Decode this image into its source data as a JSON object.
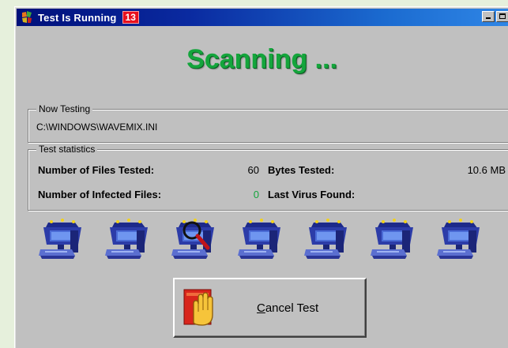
{
  "window": {
    "title": "Test Is Running",
    "badge": "13"
  },
  "headline": "Scanning ...",
  "now_testing": {
    "legend": "Now Testing",
    "path": "C:\\WINDOWS\\WAVEMIX.INI"
  },
  "stats": {
    "legend": "Test statistics",
    "files_tested_label": "Number of Files Tested:",
    "files_tested_value": "60",
    "bytes_tested_label": "Bytes Tested:",
    "bytes_tested_value": "10.6 MB",
    "infected_label": "Number of Infected Files:",
    "infected_value": "0",
    "last_virus_label": "Last Virus Found:",
    "last_virus_value": ""
  },
  "scan_icons": {
    "count": 7,
    "active_index": 2
  },
  "cancel_button": {
    "accel": "C",
    "rest": "ancel Test"
  },
  "colors": {
    "headline": "#14a53c",
    "infected_zero": "#14a53c",
    "titlebar_start": "#00107a",
    "titlebar_end": "#2f86e6"
  }
}
